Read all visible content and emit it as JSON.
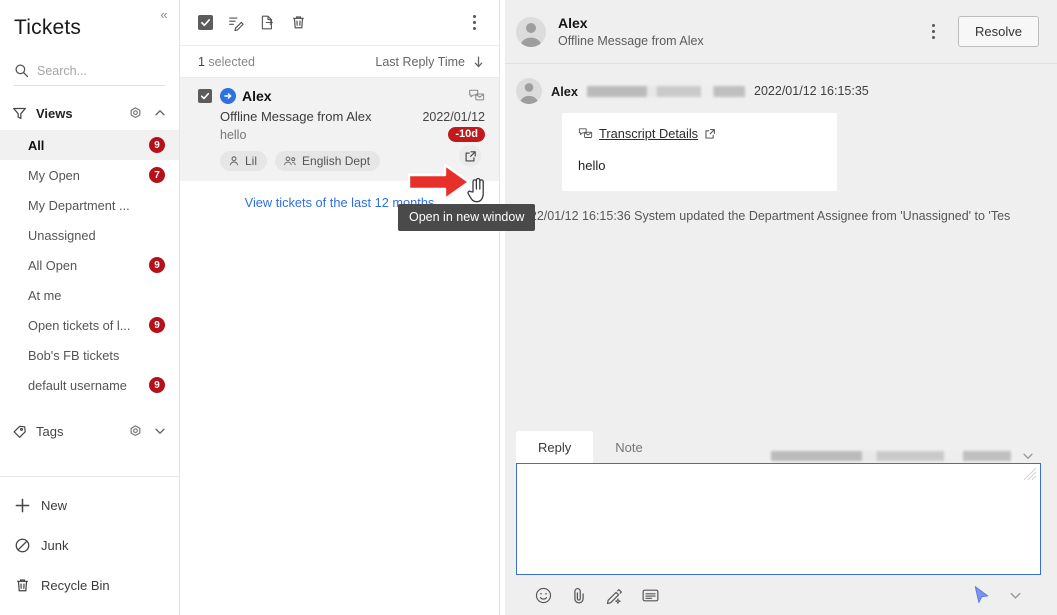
{
  "sidebar": {
    "title": "Tickets",
    "collapse_glyph": "«",
    "search": {
      "placeholder": "Search...",
      "value": ""
    },
    "sections": [
      {
        "label": "Views",
        "icon": "filter-icon",
        "settings_icon": "gear-icon",
        "chevron": "chevron-up-icon"
      },
      {
        "label": "Tags",
        "icon": "tag-icon",
        "settings_icon": "gear-icon",
        "chevron": "chevron-down-icon"
      }
    ],
    "views": [
      {
        "label": "All",
        "badge": "9",
        "active": true
      },
      {
        "label": "My Open",
        "badge": "7",
        "active": false
      },
      {
        "label": "My Department ...",
        "badge": "",
        "active": false
      },
      {
        "label": "Unassigned",
        "badge": "",
        "active": false
      },
      {
        "label": "All Open",
        "badge": "9",
        "active": false
      },
      {
        "label": "At me",
        "badge": "",
        "active": false
      },
      {
        "label": "Open tickets of l...",
        "badge": "9",
        "active": false
      },
      {
        "label": "Bob's FB tickets",
        "badge": "",
        "active": false
      },
      {
        "label": "default username",
        "badge": "9",
        "active": false
      }
    ],
    "bottom_items": [
      {
        "label": "New",
        "icon": "plus-icon"
      },
      {
        "label": "Junk",
        "icon": "block-icon"
      },
      {
        "label": "Recycle Bin",
        "icon": "trash-icon"
      }
    ]
  },
  "list": {
    "toolbar_icons": [
      "select-all-checkbox",
      "mark-read-icon",
      "export-icon",
      "delete-icon",
      "more-icon"
    ],
    "selected_text_count": "1",
    "selected_text_label": " selected",
    "sort_label": "Last Reply Time",
    "sort_direction_icon": "arrow-down-icon",
    "ticket": {
      "name": "Alex",
      "subject": "Offline Message from Alex",
      "preview": "hello",
      "date": "2022/01/12",
      "overdue_badge": "-10d",
      "channel_icon": "message-envelope-icon",
      "source_icon": "inbound-arrow-icon",
      "chips": [
        {
          "label": "Lil",
          "icon": "person-icon"
        },
        {
          "label": "English Dept",
          "icon": "group-icon"
        }
      ],
      "open_window_icon": "external-link-icon"
    },
    "view_more_label": "View tickets of the last 12 months",
    "tooltip": "Open in new window"
  },
  "detail": {
    "header": {
      "name": "Alex",
      "subtitle": "Offline Message from Alex",
      "more_icon": "more-icon",
      "resolve_label": "Resolve"
    },
    "message": {
      "author": "Alex",
      "author_meta_redacted": true,
      "timestamp": "2022/01/12 16:15:35",
      "transcript_label": "Transcript Details",
      "transcript_icon": "transcript-icon",
      "external_icon": "external-link-icon",
      "body": "hello"
    },
    "system_line": "2022/01/12 16:15:36 System updated the Department Assignee from 'Unassigned' to 'Tes",
    "editor": {
      "tabs": [
        {
          "label": "Reply",
          "active": true
        },
        {
          "label": "Note",
          "active": false
        }
      ],
      "selector_redacted": true,
      "selector_chevron": "chevron-down-icon",
      "value": "",
      "toolbar_icons": [
        "emoji-icon",
        "attachment-icon",
        "quick-reply-icon",
        "canned-response-icon"
      ],
      "send_icon": "send-cursor-icon",
      "send_chevron": "chevron-down-icon"
    }
  },
  "colors": {
    "accent_blue": "#2f6fe0",
    "badge_red": "#b5111b",
    "overdue_red": "#c21a1a",
    "annotation_red": "#e8302a",
    "panel_gray": "#efefef",
    "tooltip_bg": "#4a4a4a"
  }
}
